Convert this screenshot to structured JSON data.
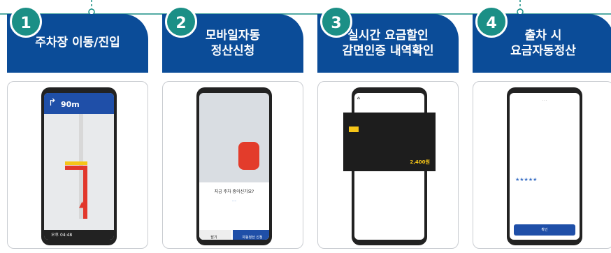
{
  "steps": [
    {
      "number": "1",
      "title": "주차장 이동/진입"
    },
    {
      "number": "2",
      "title": "모바일자동\n정산신청"
    },
    {
      "number": "3",
      "title": "실시간 요금할인\n감면인증 내역확인"
    },
    {
      "number": "4",
      "title": "출차 시\n요금자동정산"
    }
  ],
  "phone1": {
    "distance": "90m",
    "time": "오후 04:48"
  },
  "phone2": {
    "dialog_title": "지금 주차 중이신가요?",
    "left_button": "닫기",
    "right_button": "자동정산 신청"
  },
  "phone3": {
    "total": "2,400원"
  },
  "phone4": {
    "button": "확인"
  },
  "colors": {
    "header": "#0b4c98",
    "badge": "#1b8f86"
  }
}
